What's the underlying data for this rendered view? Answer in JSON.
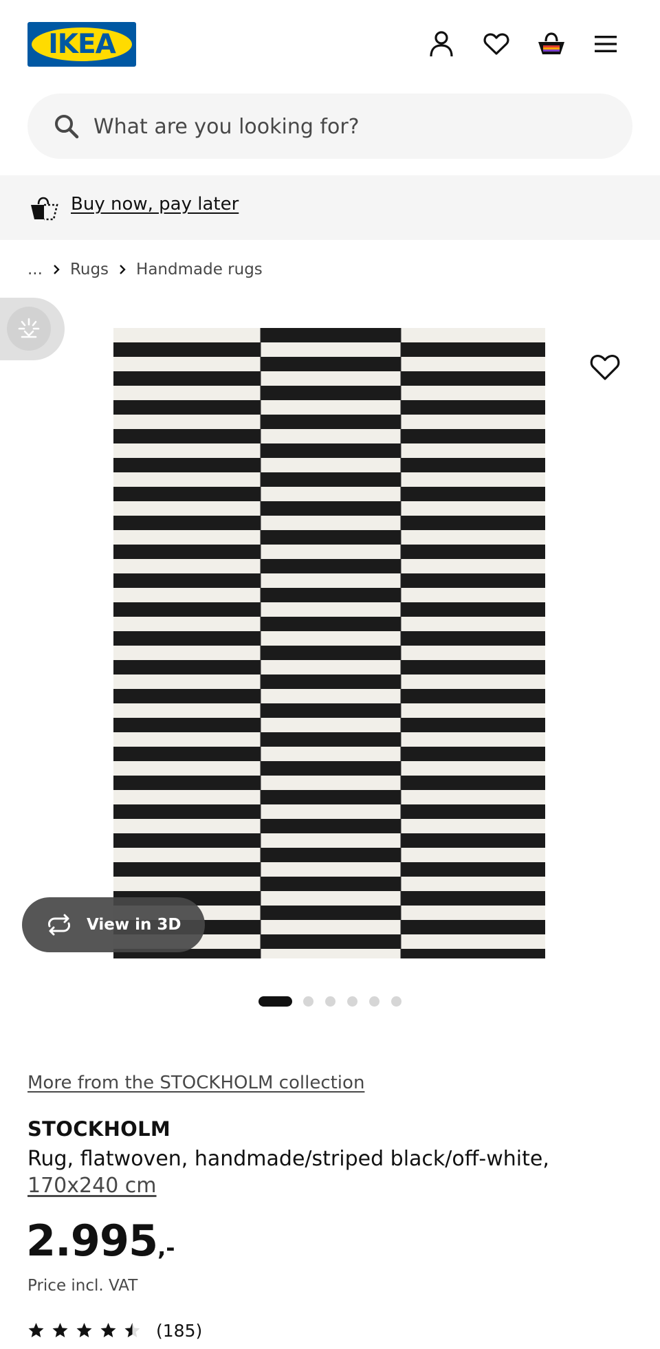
{
  "header": {
    "logo_text": "IKEA",
    "logo_colors": {
      "blue": "#0058A3",
      "yellow": "#FFDB00"
    },
    "icons": [
      "profile-icon",
      "heart-icon",
      "shopping-bag-icon",
      "hamburger-menu-icon"
    ]
  },
  "search": {
    "placeholder": "What are you looking for?",
    "value": ""
  },
  "promo": {
    "link": "Buy now, pay later",
    "icon": "pay-later-bag-icon"
  },
  "breadcrumb": {
    "items": [
      "...",
      "Rugs",
      "Handmade rugs"
    ]
  },
  "gallery": {
    "view3d_label": "View in 3D",
    "image_count": 6,
    "active_index": 0
  },
  "product": {
    "collection_link": "More from the STOCKHOLM collection",
    "name": "STOCKHOLM",
    "description": "Rug, flatwoven, handmade/striped black/off-white,",
    "size": "170x240 cm",
    "price_main": "2.995",
    "price_suffix": ",-",
    "price_note": "Price incl. VAT",
    "rating": {
      "stars": 4.5,
      "count": "(185)"
    }
  }
}
